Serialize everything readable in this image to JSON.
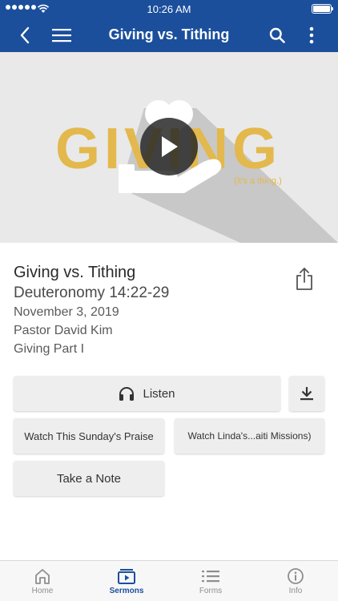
{
  "status_bar": {
    "time": "10:26 AM"
  },
  "nav": {
    "title": "Giving vs. Tithing"
  },
  "hero": {
    "graphic_word": "GIVING",
    "graphic_tagline": "(it's a thing.)"
  },
  "sermon": {
    "title": "Giving vs. Tithing",
    "passage": "Deuteronomy 14:22-29",
    "date": "November 3, 2019",
    "speaker": "Pastor David Kim",
    "series": "Giving Part I"
  },
  "actions": {
    "listen_label": "Listen",
    "watch_1_label": "Watch This Sunday's Praise",
    "watch_2_label": "Watch Linda's...aiti Missions)",
    "note_label": "Take a Note"
  },
  "tabs": [
    {
      "label": "Home",
      "icon": "home-icon"
    },
    {
      "label": "Sermons",
      "icon": "sermons-icon"
    },
    {
      "label": "Forms",
      "icon": "list-icon"
    },
    {
      "label": "Info",
      "icon": "info-icon"
    }
  ],
  "colors": {
    "brand": "#1b4f9c",
    "graphic_gold": "#e3b84c",
    "button_bg": "#eeeeee"
  }
}
